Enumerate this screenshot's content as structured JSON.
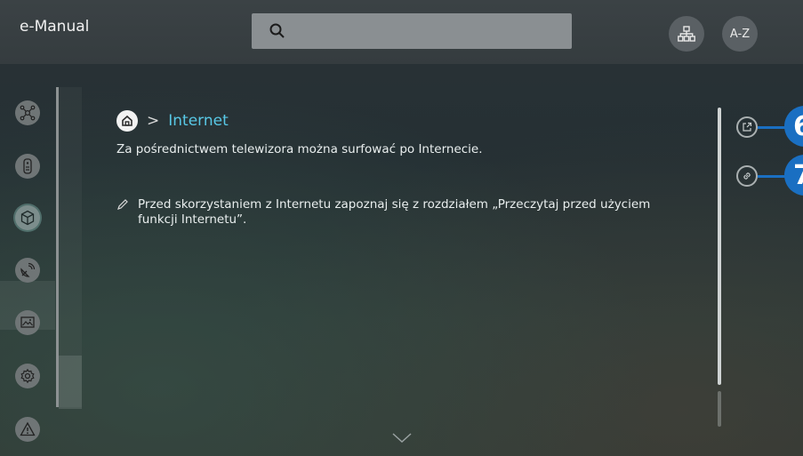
{
  "app": {
    "title": "e-Manual"
  },
  "search": {
    "placeholder": ""
  },
  "header": {
    "tree_label": "",
    "az_label": "A-Z"
  },
  "sidebar": {
    "items": [
      {
        "icon": "connections-icon"
      },
      {
        "icon": "remote-icon"
      },
      {
        "icon": "smart-features-icon"
      },
      {
        "icon": "broadcast-icon"
      },
      {
        "icon": "picture-icon"
      },
      {
        "icon": "settings-icon"
      },
      {
        "icon": "warning-icon"
      }
    ],
    "active_index": 2
  },
  "breadcrumb": {
    "label": "Internet"
  },
  "content": {
    "description": "Za pośrednictwem telewizora można surfować po Internecie.",
    "note": "Przed skorzystaniem z Internetu zapoznaj się z rozdziałem „Przeczytaj przed użyciem funkcji Internetu”."
  },
  "callouts": [
    {
      "number": "6",
      "icon": "open-link-icon"
    },
    {
      "number": "7",
      "icon": "link-icon"
    }
  ],
  "colors": {
    "accent": "#58c8e6",
    "callout": "#1a6fc2"
  }
}
